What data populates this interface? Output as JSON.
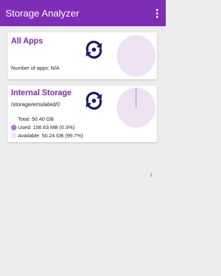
{
  "app": {
    "title": "Storage Analyzer"
  },
  "toolbar": {
    "overflow_icon": "more-vert-icon"
  },
  "cards": {
    "all_apps": {
      "title": "All Apps",
      "number_of_apps": "Number of apps: N/A"
    },
    "internal_storage": {
      "title": "Internal Storage",
      "path": "/storage/emulated/0",
      "total": "Total: 50.40 GB",
      "used": "Used: 156.63 MB (0.3%)",
      "available": "Available: 50.24 GB (99.7%)",
      "used_fraction": 0.003,
      "available_fraction": 0.997
    }
  },
  "colors": {
    "app_bar": "#7e2db8",
    "title_purple": "#7b2aa8",
    "icon_navy": "#1a1a66",
    "pie_light": "#ede1f2",
    "used_color": "#b07cc4",
    "available_color": "#ede1f2"
  }
}
